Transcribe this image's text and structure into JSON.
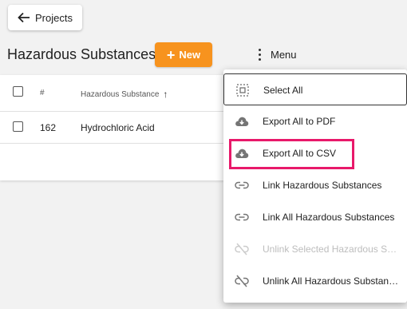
{
  "header": {
    "back_label": "Projects",
    "page_title": "Hazardous Substances",
    "new_label": "New",
    "menu_label": "Menu"
  },
  "table": {
    "columns": [
      "#",
      "Hazardous Substance"
    ],
    "rows": [
      {
        "number": "162",
        "name": "Hydrochloric Acid"
      }
    ]
  },
  "menu": {
    "items": [
      {
        "label": "Select All",
        "icon": "select-all-icon",
        "disabled": false
      },
      {
        "label": "Export All to PDF",
        "icon": "cloud-download-icon",
        "disabled": false
      },
      {
        "label": "Export All to CSV",
        "icon": "cloud-download-icon",
        "disabled": false
      },
      {
        "label": "Link Hazardous Substances",
        "icon": "link-icon",
        "disabled": false
      },
      {
        "label": "Link All Hazardous Substances",
        "icon": "link-icon",
        "disabled": false
      },
      {
        "label": "Unlink Selected Hazardous Sub...",
        "icon": "unlink-icon",
        "disabled": true
      },
      {
        "label": "Unlink All Hazardous Substanc...",
        "icon": "unlink-icon",
        "disabled": false
      }
    ]
  },
  "colors": {
    "accent_orange": "#f7931e",
    "highlight_pink": "#e8196a",
    "background": "#f2f2f2"
  }
}
